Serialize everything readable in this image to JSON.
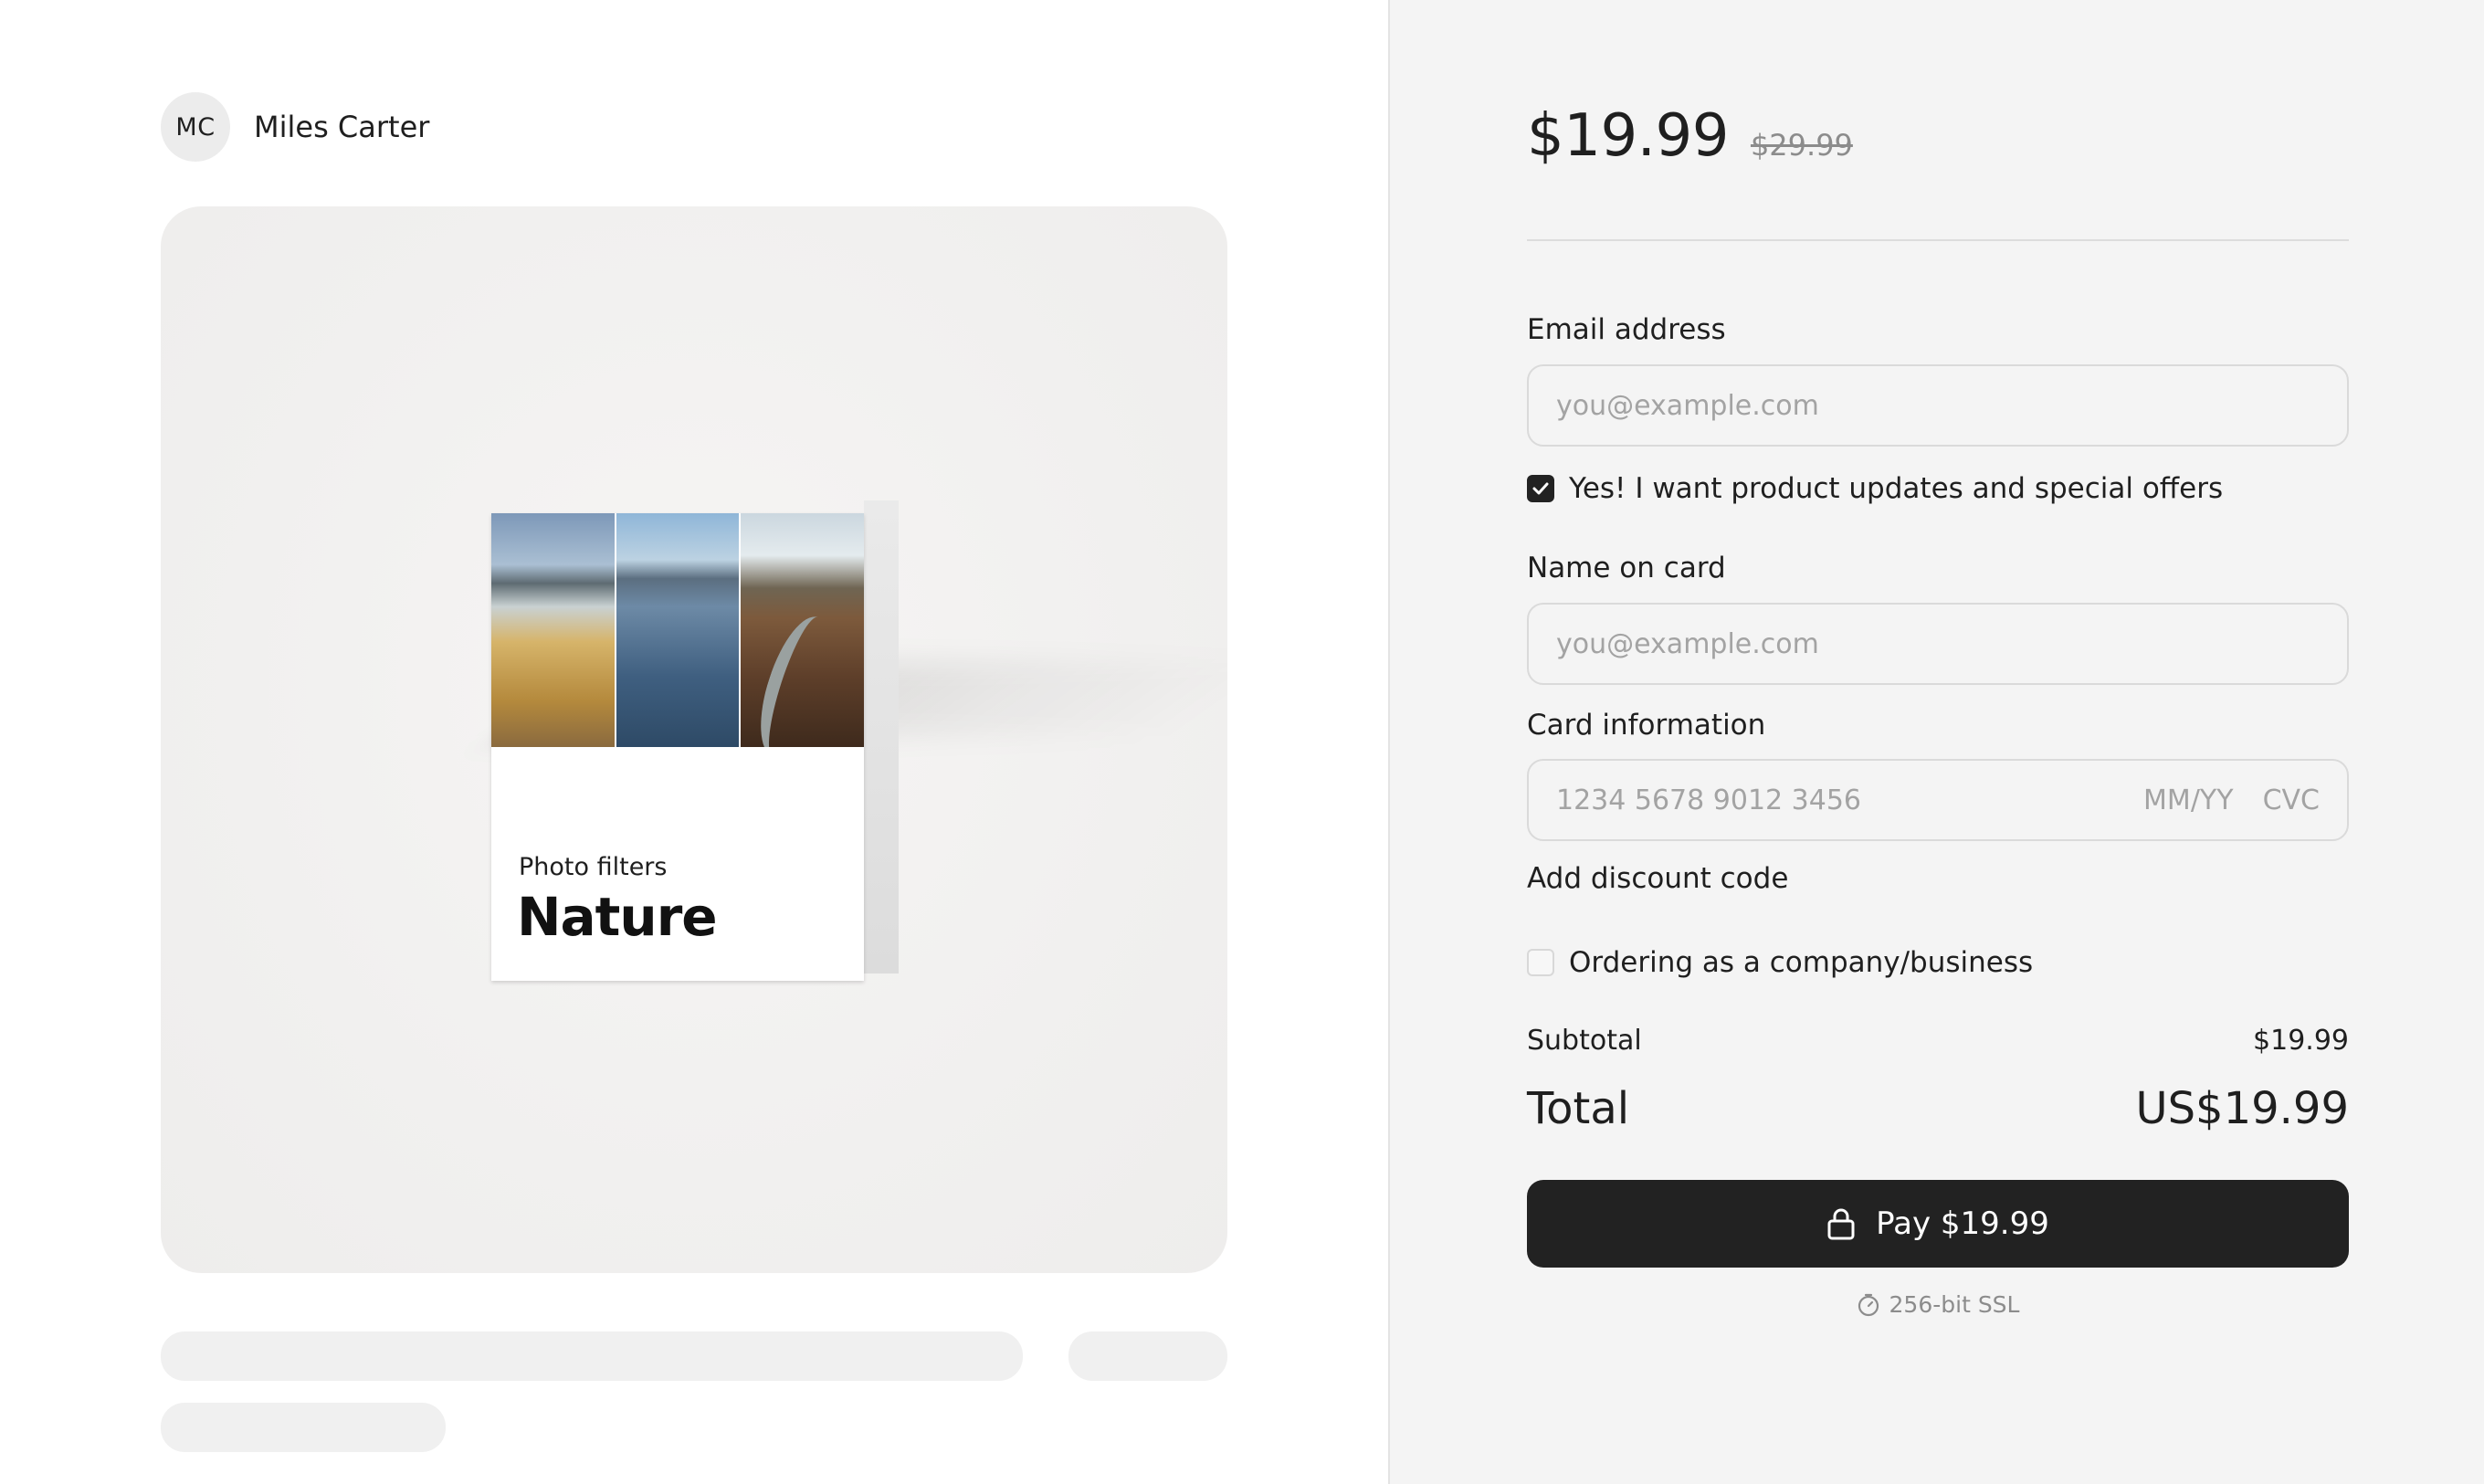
{
  "seller": {
    "initials": "MC",
    "name": "Miles Carter"
  },
  "product": {
    "subtitle": "Photo filters",
    "title": "Nature"
  },
  "checkout": {
    "price": "$19.99",
    "old_price": "$29.99",
    "email": {
      "label": "Email address",
      "placeholder": "you@example.com"
    },
    "updates_opt_in": {
      "label": "Yes! I want product updates and special offers",
      "checked": true
    },
    "name_on_card": {
      "label": "Name on card",
      "placeholder": "you@example.com"
    },
    "card": {
      "label": "Card information",
      "number_placeholder": "1234 5678 9012 3456",
      "expiry_placeholder": "MM/YY",
      "cvc_placeholder": "CVC"
    },
    "discount_link": "Add discount code",
    "company_opt": {
      "label": "Ordering as a company/business",
      "checked": false
    },
    "subtotal": {
      "label": "Subtotal",
      "value": "$19.99"
    },
    "total": {
      "label": "Total",
      "value": "US$19.99"
    },
    "pay_button": "Pay $19.99",
    "ssl_note": "256-bit SSL"
  },
  "colors": {
    "panel_bg": "#f4f4f4",
    "button_bg": "#222222",
    "skeleton": "#f0f0f0"
  }
}
